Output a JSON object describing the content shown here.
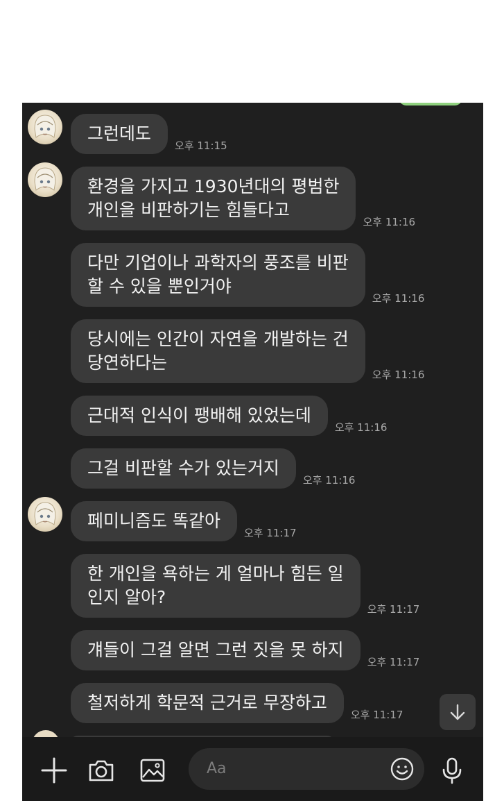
{
  "chat": {
    "messages": [
      {
        "lines": [
          "그런데도"
        ],
        "time": "오후 11:15",
        "avatar": true
      },
      {
        "lines": [
          "환경을 가지고 1930년대의 평범한",
          "개인을 비판하기는 힘들다고"
        ],
        "time": "오후 11:16",
        "avatar": true
      },
      {
        "lines": [
          "다만 기업이나 과학자의 풍조를 비판",
          "할 수 있을 뿐인거야"
        ],
        "time": "오후 11:16",
        "avatar": false
      },
      {
        "lines": [
          "당시에는 인간이 자연을 개발하는 건",
          "당연하다는"
        ],
        "time": "오후 11:16",
        "avatar": false
      },
      {
        "lines": [
          "근대적 인식이 팽배해 있었는데"
        ],
        "time": "오후 11:16",
        "avatar": false
      },
      {
        "lines": [
          "그걸 비판할 수가 있는거지"
        ],
        "time": "오후 11:16",
        "avatar": false
      },
      {
        "lines": [
          "페미니즘도 똑같아"
        ],
        "time": "오후 11:17",
        "avatar": true
      },
      {
        "lines": [
          "한 개인을 욕하는 게 얼마나 힘든 일",
          "인지 알아?"
        ],
        "time": "오후 11:17",
        "avatar": false
      },
      {
        "lines": [
          "걔들이 그걸 알면 그런 짓을 못 하지"
        ],
        "time": "오후 11:17",
        "avatar": false
      },
      {
        "lines": [
          "철저하게 학문적 근거로 무장하고"
        ],
        "time": "오후 11:17",
        "avatar": false
      }
    ]
  },
  "input": {
    "placeholder": "Aa"
  },
  "icons": {
    "add": "plus-icon",
    "camera": "camera-icon",
    "gallery": "image-icon",
    "emoji": "smiley-icon",
    "mic": "microphone-icon",
    "scroll": "arrow-down-icon"
  },
  "colors": {
    "background": "#1f1f1f",
    "bubble": "#3a3a3a",
    "text": "#f2f2f2",
    "time": "#a8a8a8",
    "accent_green": "#8fd17e"
  }
}
